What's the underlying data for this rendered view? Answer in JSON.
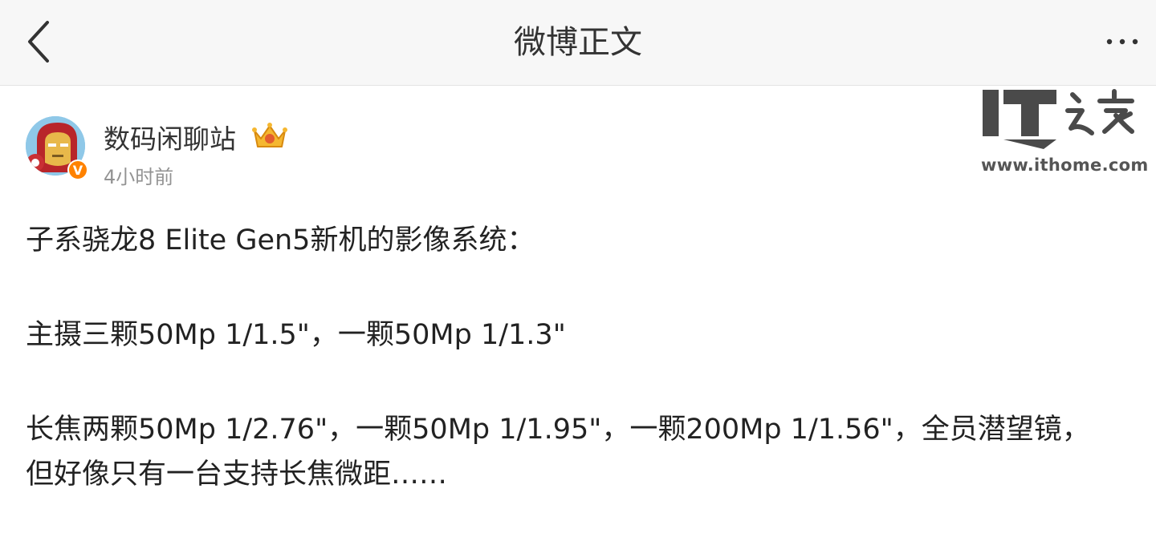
{
  "nav": {
    "title": "微博正文",
    "back_icon": "chevron-left-icon",
    "more_icon": "more-horizontal-icon"
  },
  "author": {
    "name": "数码闲聊站",
    "time": "4小时前",
    "verified_mark": "V",
    "avatar_icon": "iron-man-avatar",
    "crown_icon": "crown-badge-icon"
  },
  "watermark": {
    "logo_text": "IT之家",
    "url": "www.ithome.com"
  },
  "post": {
    "paragraphs": [
      "子系骁龙8 Elite Gen5新机的影像系统：",
      "主摄三颗50Mp 1/1.5\"，一颗50Mp 1/1.3\"",
      "长焦两颗50Mp 1/2.76\"，一颗50Mp 1/1.95\"，一颗200Mp 1/1.56\"，全员潜望镜，",
      "但好像只有一台支持长焦微距……"
    ]
  },
  "colors": {
    "nav_bg": "#f7f7f7",
    "text": "#222222",
    "muted": "#939393",
    "verified": "#ff8200"
  }
}
